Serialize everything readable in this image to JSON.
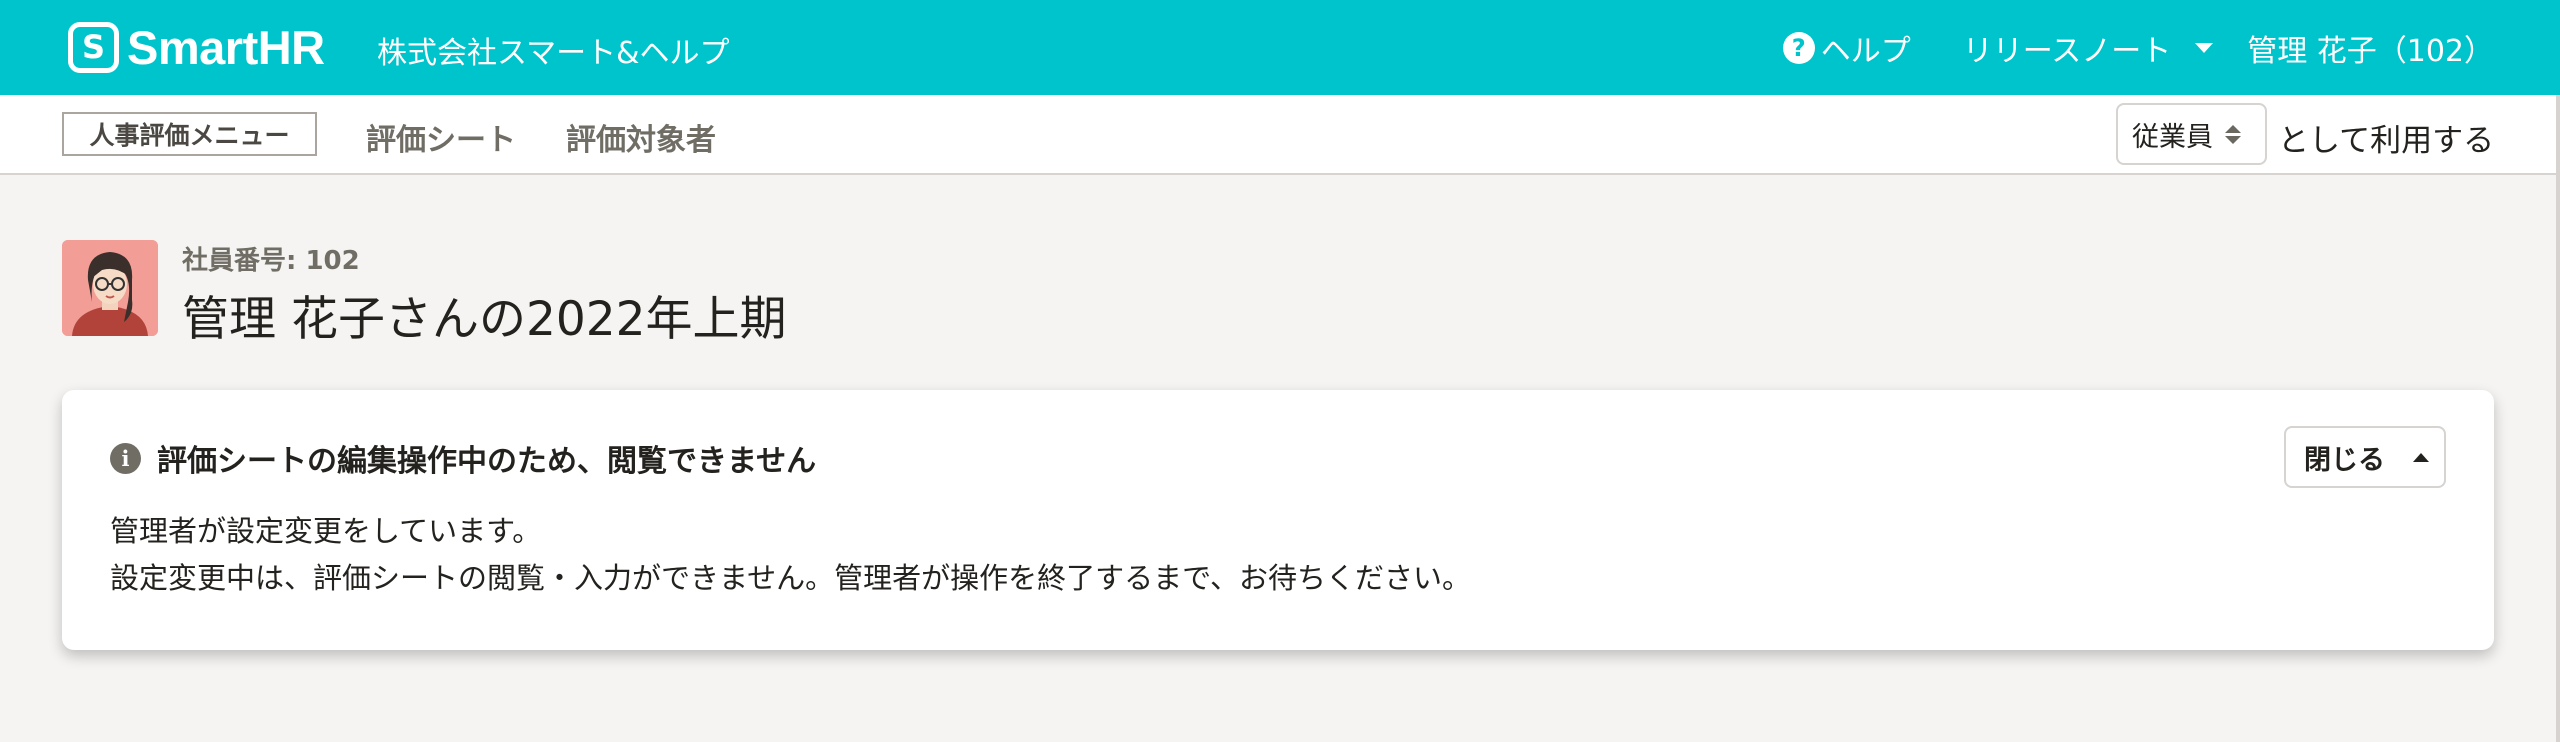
{
  "header": {
    "logo_text": "SmartHR",
    "company": "株式会社スマート&ヘルプ",
    "help_label": "ヘルプ",
    "release_notes_label": "リリースノート",
    "user_label": "管理 花子（102）"
  },
  "subnav": {
    "menu_label": "人事評価メニュー",
    "links": [
      "評価シート",
      "評価対象者"
    ],
    "role_value": "従業員",
    "role_suffix": "として利用する"
  },
  "profile": {
    "employee_number": "社員番号: 102",
    "title": "管理 花子さんの2022年上期"
  },
  "notice": {
    "title": "評価シートの編集操作中のため、閲覧できません",
    "close_label": "閉じる",
    "lines": [
      "管理者が設定変更をしています。",
      "設定変更中は、評価シートの閲覧・入力ができません。管理者が操作を終了するまで、お待ちください。"
    ]
  },
  "colors": {
    "brand": "#00c4cc",
    "background": "#f5f4f2",
    "text": "#23221e",
    "muted": "#706d65"
  },
  "icons": [
    "smarthr-logo-icon",
    "help-icon",
    "chevron-down-icon",
    "sort-icon",
    "avatar",
    "info-icon",
    "chevron-up-icon"
  ]
}
